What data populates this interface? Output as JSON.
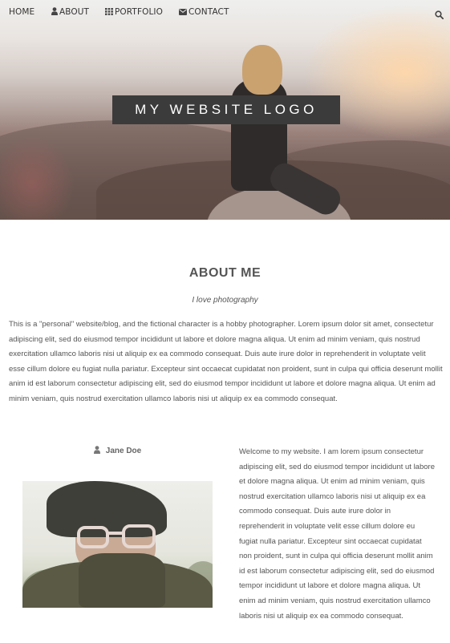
{
  "nav": {
    "items": [
      {
        "label": "HOME",
        "icon": ""
      },
      {
        "label": "ABOUT",
        "icon": "user-icon"
      },
      {
        "label": "PORTFOLIO",
        "icon": "grid-icon"
      },
      {
        "label": "CONTACT",
        "icon": "envelope-icon"
      }
    ],
    "search_icon": "search-icon"
  },
  "hero": {
    "logo_text": "MY WEBSITE LOGO"
  },
  "about": {
    "title": "ABOUT ME",
    "subtitle": "I love photography",
    "body": "This is a \"personal\" website/blog, and the fictional character is a hobby photographer. Lorem ipsum dolor sit amet, consectetur adipiscing elit, sed do eiusmod tempor incididunt ut labore et dolore magna aliqua. Ut enim ad minim veniam, quis nostrud exercitation ullamco laboris nisi ut aliquip ex ea commodo consequat. Duis aute irure dolor in reprehenderit in voluptate velit esse cillum dolore eu fugiat nulla pariatur. Excepteur sint occaecat cupidatat non proident, sunt in culpa qui officia deserunt mollit anim id est laborum consectetur adipiscing elit, sed do eiusmod tempor incididunt ut labore et dolore magna aliqua. Ut enim ad minim veniam, quis nostrud exercitation ullamco laboris nisi ut aliquip ex ea commodo consequat."
  },
  "profile": {
    "author_name": "Jane Doe",
    "author_icon": "user-icon",
    "welcome_text": "Welcome to my website. I am lorem ipsum consectetur adipiscing elit, sed do eiusmod tempor incididunt ut labore et dolore magna aliqua. Ut enim ad minim veniam, quis nostrud exercitation ullamco laboris nisi ut aliquip ex ea commodo consequat. Duis aute irure dolor in reprehenderit in voluptate velit esse cillum dolore eu fugiat nulla pariatur. Excepteur sint occaecat cupidatat non proident, sunt in culpa qui officia deserunt mollit anim id est laborum consectetur adipiscing elit, sed do eiusmod tempor incididunt ut labore et dolore magna aliqua. Ut enim ad minim veniam, quis nostrud exercitation ullamco laboris nisi ut aliquip ex ea commodo consequat."
  }
}
